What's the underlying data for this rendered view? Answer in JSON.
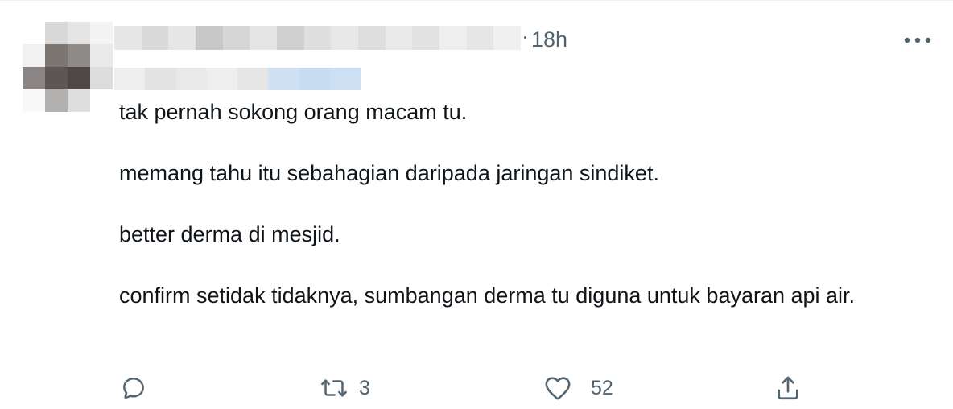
{
  "tweet": {
    "timestamp": "18h",
    "text_lines": [
      "tak pernah sokong orang macam tu.",
      "memang tahu itu sebahagian daripada jaringan sindiket.",
      "better derma di mesjid.",
      "confirm setidak tidaknya, sumbangan derma tu diguna untuk bayaran api air."
    ]
  },
  "actions": {
    "reply_icon": "reply-icon",
    "retweet_icon": "retweet-icon",
    "retweet_count": "3",
    "like_icon": "heart-icon",
    "like_count": "52",
    "share_icon": "share-icon",
    "more_icon": "more-icon"
  },
  "colors": {
    "text": "#0f1419",
    "secondary_text": "#536471",
    "icon": "#536471"
  },
  "avatar_pixels": [
    "#ffffff",
    "#d8d8d8",
    "#e4e4e4",
    "#f4f4f4",
    "#f1f1f1",
    "#7d7570",
    "#8f8b88",
    "#e9e9e9",
    "#8a8584",
    "#5e5654",
    "#4f4846",
    "#dcdcdc",
    "#f8f8f8",
    "#b3b1b0",
    "#dedede",
    "#ffffff"
  ],
  "name_pixels": [
    "#e7e7e7",
    "#dadada",
    "#e6e6e6",
    "#c8c8c8",
    "#d6d6d6",
    "#e5e5e5",
    "#cfcfcf",
    "#dfdfdf",
    "#e8e8e8",
    "#dedede",
    "#eaeaea",
    "#e2e2e2",
    "#eeeeee",
    "#e6e6e6",
    "#f0f0f0"
  ],
  "handle_pixels": [
    "#eeeeee",
    "#e3e3e3",
    "#e9e9e9",
    "#eeeeee",
    "#e6e6e6",
    "#cfe0f3",
    "#c7dbf1",
    "#cddff2"
  ]
}
